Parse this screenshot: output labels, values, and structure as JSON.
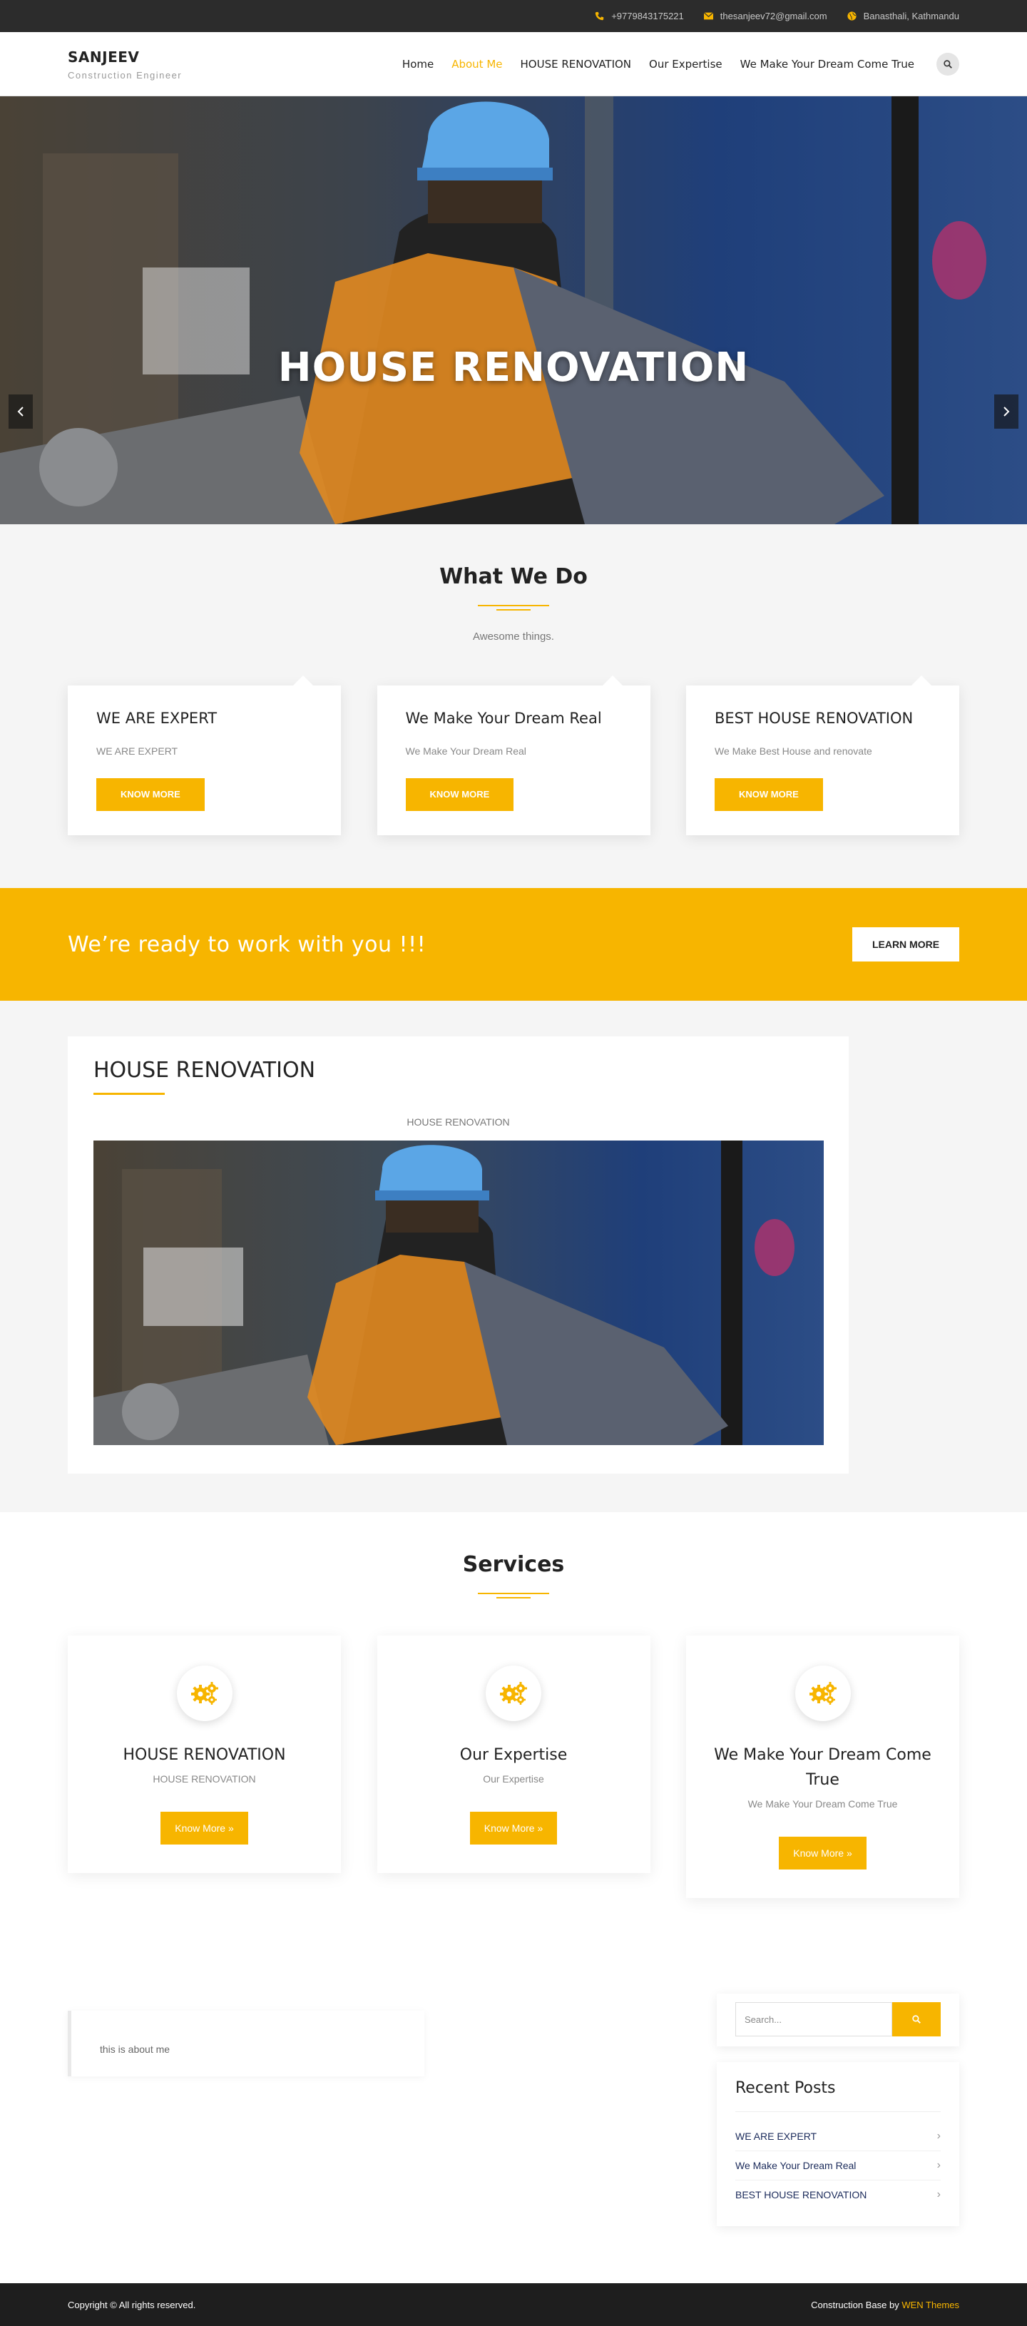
{
  "topbar": {
    "phone": "+9779843175221",
    "email": "thesanjeev72@gmail.com",
    "address": "Banasthali, Kathmandu"
  },
  "brand": {
    "name": "SANJEEV",
    "tagline": "Construction Engineer"
  },
  "nav": {
    "items": [
      {
        "label": "Home"
      },
      {
        "label": "About Me"
      },
      {
        "label": "HOUSE RENOVATION"
      },
      {
        "label": "Our Expertise"
      },
      {
        "label": "We Make Your Dream Come True"
      }
    ],
    "active": "About Me"
  },
  "hero": {
    "title": "HOUSE RENOVATION",
    "slide_count": 3,
    "active_slide": 1
  },
  "what_we_do": {
    "title": "What We Do",
    "subtitle": "Awesome things.",
    "cards": [
      {
        "title": "WE ARE EXPERT",
        "text": "WE ARE EXPERT",
        "button": "KNOW MORE"
      },
      {
        "title": "We Make Your Dream Real",
        "text": "We Make Your Dream Real",
        "button": "KNOW MORE"
      },
      {
        "title": "BEST HOUSE RENOVATION",
        "text": "We Make Best House and renovate",
        "button": "KNOW MORE"
      }
    ]
  },
  "cta": {
    "text": "We’re ready to work with you !!!",
    "button": "LEARN MORE"
  },
  "post": {
    "title": "HOUSE RENOVATION",
    "caption": "HOUSE RENOVATION"
  },
  "services": {
    "title": "Services",
    "cards": [
      {
        "title": "HOUSE RENOVATION",
        "text": "HOUSE RENOVATION",
        "button": "Know More »"
      },
      {
        "title": "Our Expertise",
        "text": "Our Expertise",
        "button": "Know More »"
      },
      {
        "title": "We Make Your Dream Come True",
        "text": "We Make Your Dream Come True",
        "button": "Know More »"
      }
    ]
  },
  "about": {
    "text": "this is about me"
  },
  "sidebar": {
    "search_placeholder": "Search...",
    "recent_title": "Recent Posts",
    "recent_posts": [
      {
        "label": "WE ARE EXPERT"
      },
      {
        "label": "We Make Your Dream Real"
      },
      {
        "label": "BEST HOUSE RENOVATION"
      }
    ]
  },
  "footer": {
    "copyright": "Copyright © All rights reserved.",
    "credit_prefix": "Construction Base by",
    "credit_link": "WEN Themes"
  },
  "colors": {
    "accent": "#f7b500",
    "topbar": "#2c2c2c",
    "footer": "#1e1e1e"
  }
}
